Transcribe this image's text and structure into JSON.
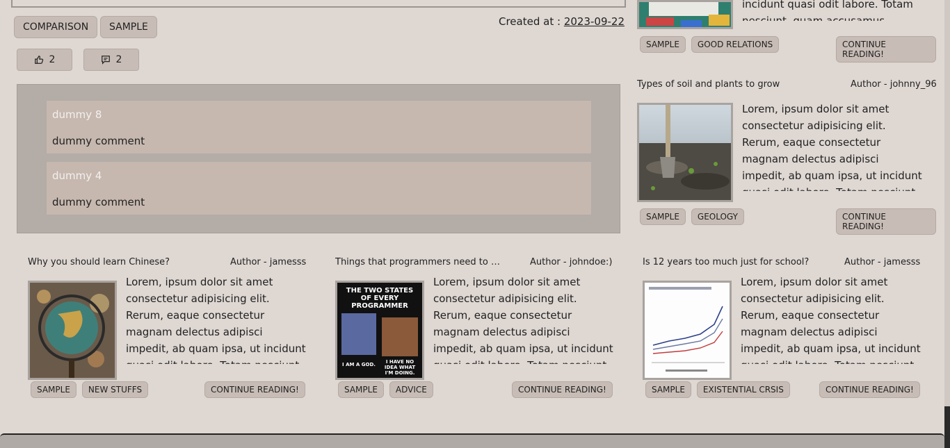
{
  "post": {
    "tags": [
      "COMPARISON",
      "SAMPLE"
    ],
    "created_label": "Created at :",
    "created_date": "2023-09-22",
    "likes": "2",
    "comments_count": "2"
  },
  "comments": [
    {
      "author": "dummy 8",
      "body": "dummy comment"
    },
    {
      "author": "dummy 4",
      "body": "dummy comment"
    }
  ],
  "sidebar_cards": [
    {
      "excerpt": "incidunt quasi odit labore. Totam nesciunt, quam accusamus",
      "tags": [
        "SAMPLE",
        "GOOD RELATIONS"
      ],
      "continue_label": "CONTINUE READING!"
    },
    {
      "title": "Types of soil and plants to grow",
      "author": "Author - johnny_96",
      "excerpt": "Lorem, ipsum dolor sit amet consectetur adipisicing elit. Rerum, eaque consectetur magnam delectus adipisci impedit, ab quam ipsa, ut incidunt quasi odit labore. Totam nesciunt, quam accusamus",
      "tags": [
        "SAMPLE",
        "GEOLOGY"
      ],
      "continue_label": "CONTINUE READING!"
    }
  ],
  "cards": [
    {
      "title": "Why you should learn Chinese?",
      "author": "Author - jamesss",
      "excerpt": "Lorem, ipsum dolor sit amet consectetur adipisicing elit. Rerum, eaque consectetur magnam delectus adipisci impedit, ab quam ipsa, ut incidunt quasi odit labore. Totam nesciunt, quam accusamus",
      "tags": [
        "SAMPLE",
        "NEW STUFFS"
      ],
      "continue_label": "CONTINUE READING!"
    },
    {
      "title": "Things that programmers need to ca...",
      "author": "Author - johndoe:)",
      "excerpt": "Lorem, ipsum dolor sit amet consectetur adipisicing elit. Rerum, eaque consectetur magnam delectus adipisci impedit, ab quam ipsa, ut incidunt quasi odit labore. Totam nesciunt, quam accusamus",
      "tags": [
        "SAMPLE",
        "ADVICE"
      ],
      "continue_label": "CONTINUE READING!",
      "image_text": {
        "top": "THE TWO STATES OF EVERY PROGRAMMER",
        "left": "I AM A GOD.",
        "right": "I HAVE NO IDEA WHAT I'M DOING."
      }
    },
    {
      "title": "Is 12 years too much just for school?",
      "author": "Author - jamesss",
      "excerpt": "Lorem, ipsum dolor sit amet consectetur adipisicing elit. Rerum, eaque consectetur magnam delectus adipisci impedit, ab quam ipsa, ut incidunt quasi odit labore. Totam nesciunt, quam accusamus",
      "tags": [
        "SAMPLE",
        "EXISTENTIAL CRSIS"
      ],
      "continue_label": "CONTINUE READING!"
    }
  ],
  "colors": {
    "background": "#ded7d2",
    "tag": "#c8bdb6",
    "comments_panel": "#b3aca7",
    "comment": "#c6b8af"
  },
  "icons": {
    "like": "thumbs-up-icon",
    "comment": "comment-icon"
  }
}
